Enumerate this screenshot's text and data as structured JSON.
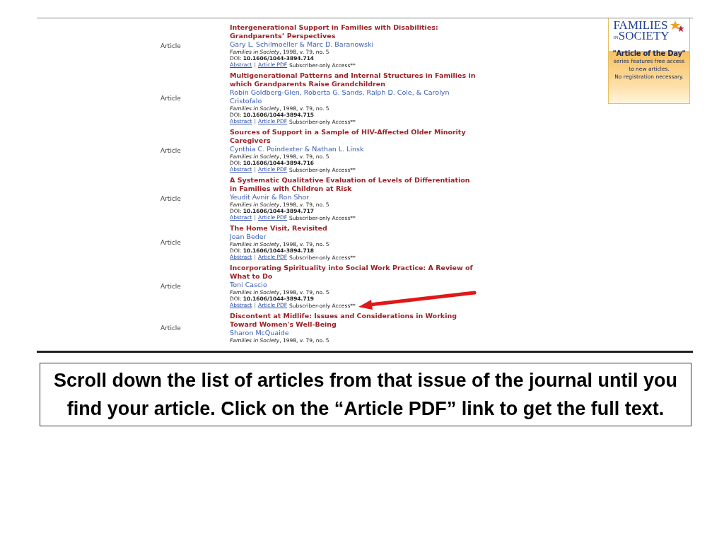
{
  "articles": [
    {
      "type": "Article",
      "title": "Intergenerational Support in Families with Disabilities: Grandparents’ Perspectives",
      "authors": "Gary L. Schilmoeller & Marc D. Baranowski",
      "citation": "*Families in Society*, 1998,  v. 79, no. 5",
      "doi": "DOI: **10.1606/1044-3894.714**",
      "links": [
        "Abstract",
        "Article PDF"
      ],
      "separator": "|",
      "access": "Subscriber-only Access**"
    },
    {
      "type": "Article",
      "title": "Multigenerational Patterns and Internal Structures in Families in which Grandparents Raise Grandchildren",
      "authors": "Robin Goldberg-Glen, Roberta G. Sands, Ralph D. Cole, & Carolyn Cristofalo",
      "citation": "*Families in Society*, 1998,  v. 79, no. 5",
      "doi": "DOI: **10.1606/1044-3894.715**",
      "links": [
        "Abstract",
        "Article PDF"
      ],
      "separator": "|",
      "access": "Subscriber-only Access**"
    },
    {
      "type": "Article",
      "title": "Sources of Support in a Sample of HIV-Affected Older Minority Caregivers",
      "authors": "Cynthia C. Poindexter & Nathan L. Linsk",
      "citation": "*Families in Society*, 1998,  v. 79, no. 5",
      "doi": "DOI: **10.1606/1044-3894.716**",
      "links": [
        "Abstract",
        "Article PDF"
      ],
      "separator": "|",
      "access": "Subscriber-only Access**"
    },
    {
      "type": "Article",
      "title": "A Systematic Qualitative Evaluation of Levels of Differentiation in Families with Children at Risk",
      "authors": "Yeudit Avnir & Ron Shor",
      "citation": "*Families in Society*, 1998,  v. 79, no. 5",
      "doi": "DOI: **10.1606/1044-3894.717**",
      "links": [
        "Abstract",
        "Article PDF"
      ],
      "separator": "|",
      "access": "Subscriber-only Access**"
    },
    {
      "type": "Article",
      "title": "The Home Visit, Revisited",
      "authors": "Joan Beder",
      "citation": "*Families in Society*, 1998,  v. 79, no. 5",
      "doi": "DOI: **10.1606/1044-3894.718**",
      "links": [
        "Abstract",
        "Article PDF"
      ],
      "separator": "|",
      "access": "Subscriber-only Access**"
    },
    {
      "type": "Article",
      "title": "Incorporating Spirituality into Social Work Practice: A Review of What to Do",
      "authors": "Toni Cascio",
      "citation": "*Families in Society*, 1998,  v. 79, no. 5",
      "doi": "DOI: **10.1606/1044-3894.719**",
      "links": [
        "Abstract",
        "Article PDF"
      ],
      "separator": "|",
      "access": "Subscriber-only Access**",
      "pointed": true
    },
    {
      "type": "Article",
      "title": "Discontent at Midlife: Issues and Considerations in Working Toward Women's Well-Being",
      "authors": "Sharon McQuaide",
      "citation": "*Families in Society*, 1998,  v. 79, no. 5"
    }
  ],
  "promo": {
    "logo_top": "FAMILIES",
    "logo_in": "IN",
    "logo_bottom": "SOCIETY",
    "heading": "\"Article of the Day\"",
    "lines": [
      "series features free access",
      "to new articles.",
      "No registration necessary."
    ]
  },
  "caption": "Scroll down the list of articles from that issue of the journal until you find your article. Click on the “Article PDF” link to get the full text."
}
